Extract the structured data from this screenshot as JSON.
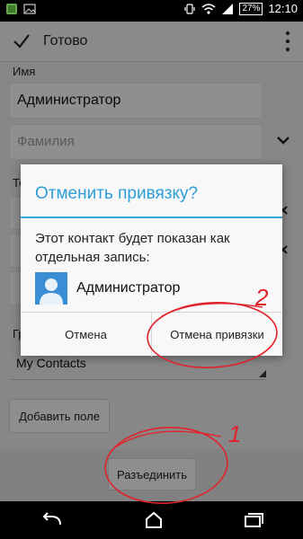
{
  "status_bar": {
    "battery": "27%",
    "time": "12:10"
  },
  "action_bar": {
    "done_label": "Готово"
  },
  "form": {
    "name_label": "Имя",
    "first_name_value": "Администратор",
    "last_name_placeholder": "Фамилия",
    "phone_label_partial": "Те",
    "group_label_partial": "Гр",
    "group_value": "My Contacts",
    "add_field_label": "Добавить поле"
  },
  "bottom_bar": {
    "unlink_label": "Разъединить"
  },
  "dialog": {
    "title": "Отменить привязку?",
    "message": "Этот контакт будет показан как отдельная запись:",
    "contact_name": "Администратор",
    "cancel_label": "Отмена",
    "confirm_label": "Отмена привязки"
  },
  "annotations": {
    "mark_1": "1",
    "mark_2": "2"
  },
  "colors": {
    "accent": "#2d9fd8",
    "annotation_red": "#e0232a",
    "avatar_blue": "#3a8fd4"
  },
  "icons": [
    "app-icon",
    "image-icon",
    "vibrate-icon",
    "wifi-icon",
    "signal-icon",
    "battery-icon",
    "check-icon",
    "overflow-menu-icon",
    "chevron-down-icon",
    "close-icon",
    "contact-avatar-icon",
    "back-icon",
    "home-icon",
    "recent-apps-icon"
  ]
}
